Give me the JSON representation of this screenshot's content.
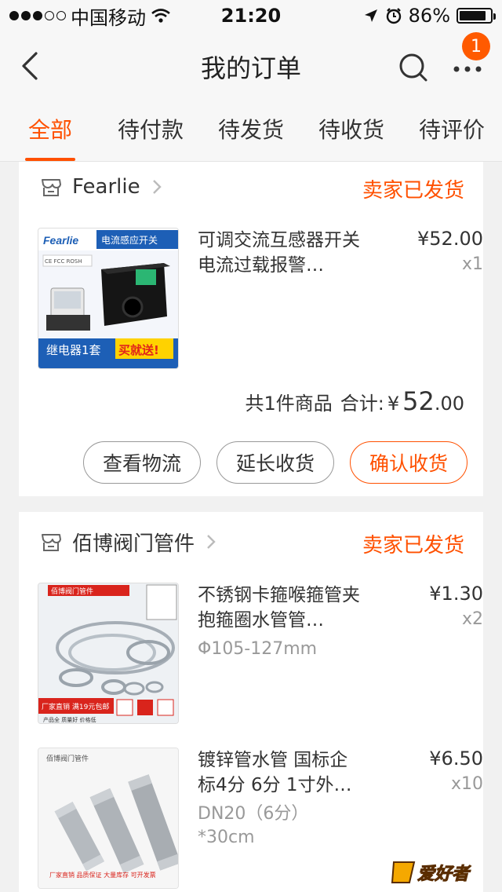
{
  "status_bar": {
    "carrier": "中国移动",
    "time": "21:20",
    "battery": "86%",
    "battery_level": 0.86,
    "signal_bars_filled": 3,
    "signal_bars_total": 5
  },
  "nav": {
    "title": "我的订单",
    "badge_count": "1",
    "icons": [
      "chevron-left-icon",
      "search-icon",
      "more-icon"
    ]
  },
  "tabs": [
    {
      "label": "全部",
      "active": true
    },
    {
      "label": "待付款",
      "active": false
    },
    {
      "label": "待发货",
      "active": false
    },
    {
      "label": "待收货",
      "active": false
    },
    {
      "label": "待评价",
      "active": false
    }
  ],
  "orders": [
    {
      "shop_name": "Fearlie",
      "status": "卖家已发货",
      "product": {
        "title": "可调交流互感器开关 电流过载报警…",
        "price": "¥52.00",
        "qty": "x1",
        "image_text": {
          "brand": "Fearlie",
          "banner": "电流感应开关",
          "cert": "CE FCC ROSH",
          "promo_left": "继电器1套",
          "promo_right": "买就送!"
        }
      },
      "summary": {
        "count_text": "共1件商品",
        "total_label": "合计:",
        "currency": "¥",
        "total_int": "52",
        "total_dec": ".00"
      },
      "buttons": [
        "查看物流",
        "延长收货",
        "确认收货"
      ]
    },
    {
      "shop_name": "佰博阀门管件",
      "status": "卖家已发货",
      "products": [
        {
          "title": "不锈钢卡箍喉箍管夹抱箍圈水管管…",
          "spec": "Φ105-127mm",
          "price": "¥1.30",
          "qty": "x2",
          "image_text": {
            "header": "佰博阀门管件",
            "promo": "厂家直销 满19元包邮",
            "sub": "产品全 质量好 价格低"
          }
        },
        {
          "title": "镀锌管水管 国标企标4分 6分 1寸外…",
          "spec": "DN20（6分）*30cm",
          "price": "¥6.50",
          "qty": "x10",
          "image_text": {
            "header": "佰博阀门管件",
            "footer": "厂家直销 品质保证 大量库存 可开发票"
          }
        }
      ]
    }
  ],
  "watermark": "爱好者",
  "colors": {
    "accent": "#ff5000",
    "badge": "#ff5a00",
    "text": "#333333",
    "muted": "#999999",
    "background": "#f1f1f1"
  }
}
